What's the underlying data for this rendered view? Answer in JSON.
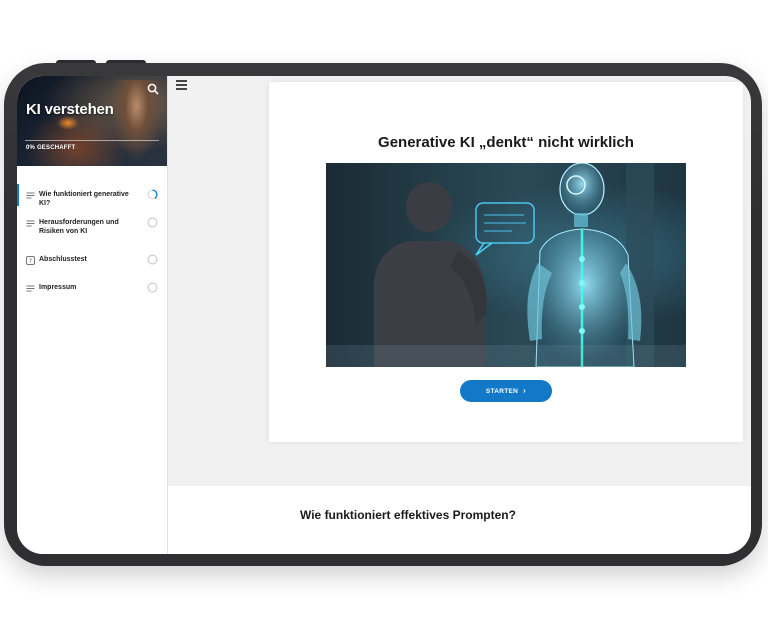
{
  "sidebar": {
    "course_title": "KI verstehen",
    "progress_label": "0% GESCHAFFT",
    "items": [
      {
        "label": "Wie funktioniert generative KI?",
        "status": "in-progress",
        "icon": "text-lines-icon"
      },
      {
        "label": "Herausforderungen und Risiken von KI",
        "status": "not-started",
        "icon": "text-lines-icon"
      },
      {
        "label": "Abschlusstest",
        "status": "not-started",
        "icon": "quiz-question-icon"
      },
      {
        "label": "Impressum",
        "status": "not-started",
        "icon": "text-lines-icon"
      }
    ]
  },
  "main": {
    "lesson_title": "Generative KI „denkt“ nicht wirklich",
    "start_button_label": "STARTEN",
    "next_section_title": "Wie funktioniert effektives Prompten?"
  },
  "colors": {
    "accent": "#1478c8",
    "frame": "#2f2f31",
    "screen_background": "#f1f1f2"
  }
}
